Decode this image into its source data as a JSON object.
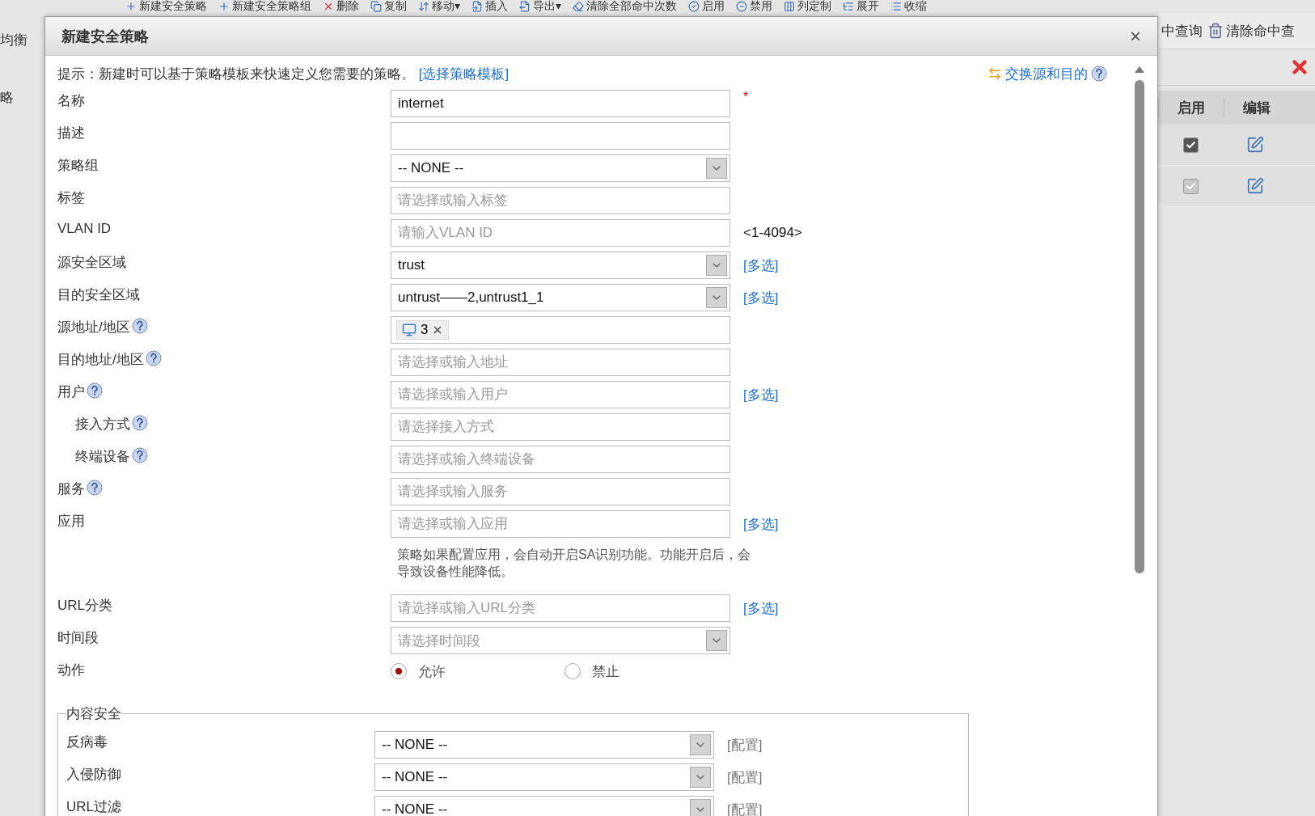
{
  "background": {
    "toolbar": [
      "新建安全策略",
      "新建安全策略组",
      "删除",
      "复制",
      "移动▾",
      "插入",
      "导出▾",
      "清除全部命中次数",
      "启用",
      "禁用",
      "列定制",
      "展开",
      "收缩"
    ],
    "sidebar": [
      "均衡",
      "略"
    ],
    "right_toolbar": [
      "中查询",
      "清除命中查"
    ],
    "table": {
      "columns": [
        "启用",
        "编辑"
      ],
      "rows": [
        {
          "checked": true,
          "disabled": false
        },
        {
          "checked": true,
          "disabled": true
        }
      ]
    }
  },
  "dialog": {
    "title": "新建安全策略",
    "close": "×",
    "hint": "提示：新建时可以基于策略模板来快速定义您需要的策略。",
    "hint_link": "[选择策略模板]",
    "swap_link": "交换源和目的",
    "fields": [
      {
        "kind": "text",
        "label": "名称",
        "value": "internet",
        "required_mark": "*"
      },
      {
        "kind": "text",
        "label": "描述"
      },
      {
        "kind": "select",
        "label": "策略组",
        "value": "-- NONE --"
      },
      {
        "kind": "text",
        "label": "标签",
        "placeholder": "请选择或输入标签"
      },
      {
        "kind": "text",
        "label": "VLAN ID",
        "placeholder": "请输入VLAN ID",
        "suffix": "<1-4094>"
      },
      {
        "kind": "select",
        "label": "源安全区域",
        "value": "trust",
        "link": "[多选]"
      },
      {
        "kind": "select",
        "label": "目的安全区域",
        "value": "untrust——2,untrust1_1",
        "link": "[多选]"
      },
      {
        "kind": "tags",
        "label": "源地址/地区",
        "help": true,
        "tags": [
          {
            "label": "3"
          }
        ]
      },
      {
        "kind": "text",
        "label": "目的地址/地区",
        "help": true,
        "placeholder": "请选择或输入地址"
      },
      {
        "kind": "text",
        "label": "用户",
        "help": true,
        "placeholder": "请选择或输入用户",
        "link": "[多选]",
        "children": [
          {
            "kind": "text",
            "label": "接入方式",
            "help": true,
            "placeholder": "请选择接入方式"
          },
          {
            "kind": "text",
            "label": "终端设备",
            "help": true,
            "placeholder": "请选择或输入终端设备"
          }
        ]
      },
      {
        "kind": "text",
        "label": "服务",
        "help": true,
        "placeholder": "请选择或输入服务"
      },
      {
        "kind": "text",
        "label": "应用",
        "placeholder": "请选择或输入应用",
        "link": "[多选]",
        "note": "策略如果配置应用，会自动开启SA识别功能。功能开启后，会导致设备性能降低。"
      },
      {
        "kind": "text",
        "label": "URL分类",
        "placeholder": "请选择或输入URL分类",
        "link": "[多选]"
      },
      {
        "kind": "select",
        "label": "时间段",
        "placeholder": "请选择时间段"
      },
      {
        "kind": "radio",
        "label": "动作",
        "options": [
          {
            "label": "允许",
            "selected": true
          },
          {
            "label": "禁止",
            "selected": false
          }
        ]
      }
    ],
    "content_security": {
      "legend": "内容安全",
      "fields": [
        {
          "label": "反病毒",
          "value": "-- NONE --",
          "link": "[配置]"
        },
        {
          "label": "入侵防御",
          "value": "-- NONE --",
          "link": "[配置]"
        },
        {
          "label": "URL过滤",
          "value": "-- NONE --",
          "link": "[配置]"
        }
      ]
    }
  }
}
